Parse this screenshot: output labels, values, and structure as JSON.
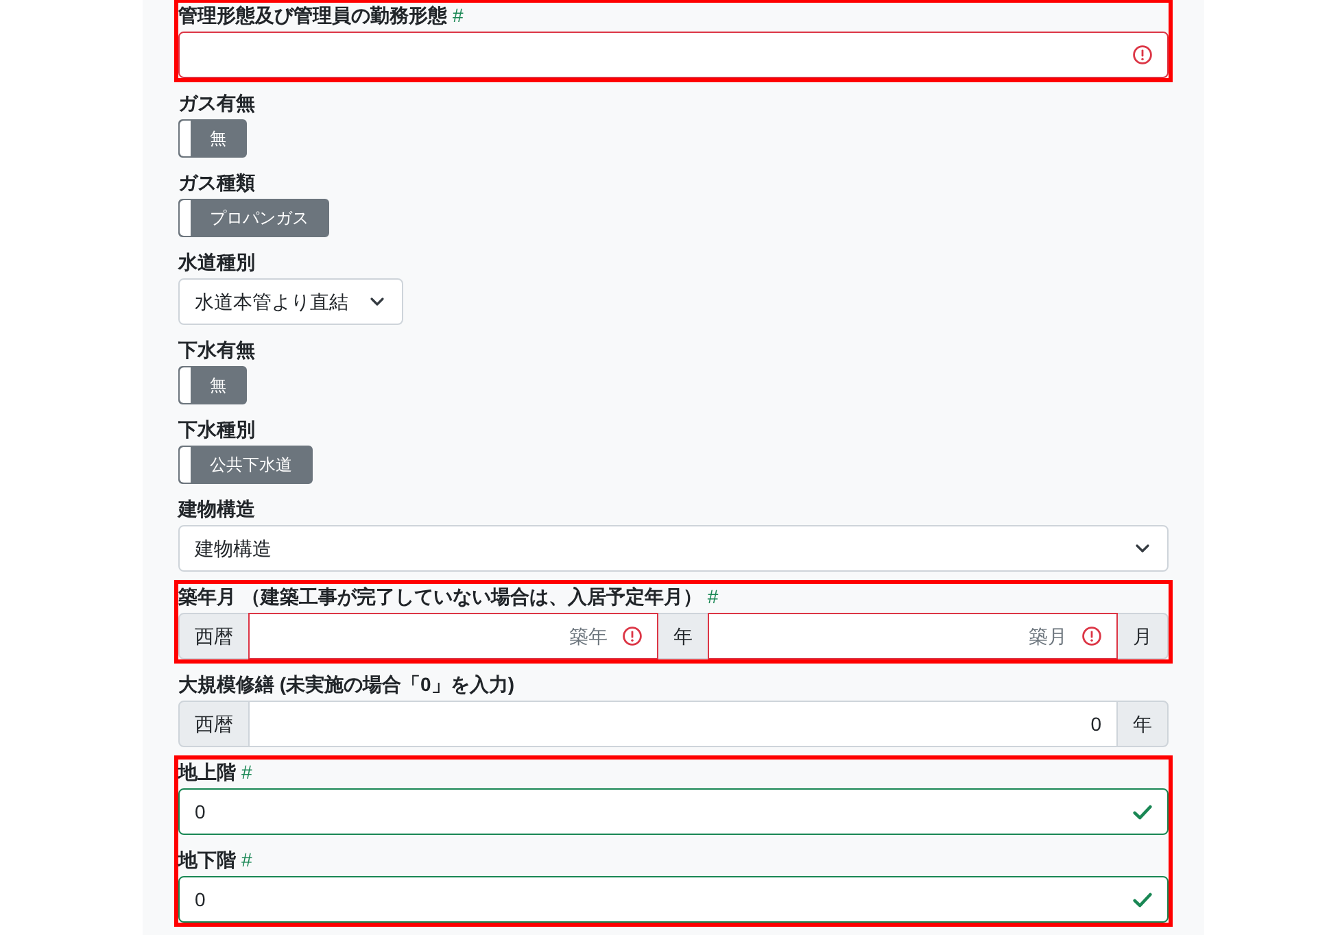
{
  "groups": [
    {
      "highlighted": true,
      "fields": [
        {
          "kind": "input_group",
          "label": "管理形態及び管理員の勤務形態",
          "mark": "#",
          "parts": [
            {
              "kind": "input",
              "error": true
            }
          ]
        }
      ]
    },
    {
      "highlighted": false,
      "fields": [
        {
          "kind": "toggle",
          "label": "ガス有無",
          "value": "無",
          "on": false
        },
        {
          "kind": "toggle",
          "label": "ガス種類",
          "value": "プロパンガス",
          "on": false
        },
        {
          "kind": "select",
          "label": "水道種別",
          "value": "水道本管より直結",
          "compact": true
        },
        {
          "kind": "toggle",
          "label": "下水有無",
          "value": "無",
          "on": false
        },
        {
          "kind": "toggle",
          "label": "下水種別",
          "value": "公共下水道",
          "on": false
        },
        {
          "kind": "select",
          "label": "建物構造",
          "value": "建物構造",
          "compact": false
        }
      ]
    },
    {
      "highlighted": true,
      "fields": [
        {
          "kind": "input_group",
          "label": "築年月 （建築工事が完了していない場合は、入居予定年月）",
          "mark": "#",
          "parts": [
            {
              "kind": "addon",
              "text": "西暦"
            },
            {
              "kind": "input",
              "placeholder": "築年",
              "error": true
            },
            {
              "kind": "addon",
              "text": "年"
            },
            {
              "kind": "input",
              "placeholder": "築月",
              "error": true
            },
            {
              "kind": "addon",
              "text": "月"
            }
          ]
        }
      ]
    },
    {
      "highlighted": false,
      "fields": [
        {
          "kind": "input_group",
          "label": "大規模修繕 (未実施の場合「0」を入力)",
          "parts": [
            {
              "kind": "addon",
              "text": "西暦"
            },
            {
              "kind": "input",
              "value": "0",
              "error": false,
              "valid": false
            },
            {
              "kind": "addon",
              "text": "年"
            }
          ]
        }
      ]
    },
    {
      "highlighted": true,
      "fields": [
        {
          "kind": "input_group",
          "label": "地上階",
          "mark": "#",
          "parts": [
            {
              "kind": "input",
              "value": "0",
              "error": false,
              "valid": true
            }
          ]
        },
        {
          "kind": "input_group",
          "label": "地下階",
          "mark": "#",
          "parts": [
            {
              "kind": "input",
              "value": "0",
              "error": false,
              "valid": true
            }
          ]
        }
      ]
    }
  ]
}
